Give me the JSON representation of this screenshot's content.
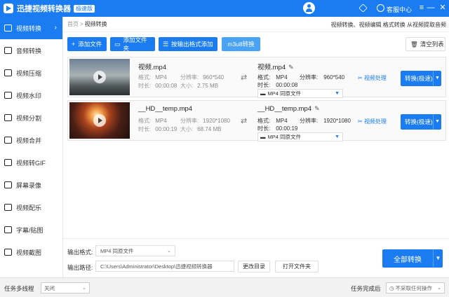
{
  "app": {
    "title": "迅捷视频转换器",
    "edition": "极速版",
    "support_label": "客服中心"
  },
  "sidebar": {
    "items": [
      {
        "label": "视频转换",
        "active": true
      },
      {
        "label": "音频转换"
      },
      {
        "label": "视频压缩"
      },
      {
        "label": "视频水印"
      },
      {
        "label": "视频分割"
      },
      {
        "label": "视频合并"
      },
      {
        "label": "视频转GIF"
      },
      {
        "label": "屏幕录像"
      },
      {
        "label": "视频配乐"
      },
      {
        "label": "字幕/贴图"
      },
      {
        "label": "视频截图"
      }
    ]
  },
  "breadcrumb": {
    "home": "首页",
    "separator": ">",
    "current": "视频转换",
    "links": "视频转换、视频编辑 格式转换 从视频提取音频"
  },
  "toolbar": {
    "add_file": "添加文件",
    "add_folder": "添加文件夹",
    "format_add": "按输出格式添加",
    "m3u8": "m3u8转换",
    "clear": "清空列表"
  },
  "files": [
    {
      "name": "视频.mp4",
      "format_label": "格式:",
      "format": "MP4",
      "res_label": "分辨率:",
      "resolution": "960*540",
      "duration_label": "时长:",
      "duration": "00:00:08",
      "size_label": "大小:",
      "size": "2.75 MB",
      "out_name": "视频.mp4",
      "out_format": "MP4",
      "out_resolution": "960*540",
      "out_duration": "00:00:08",
      "out_select": "MP4 同原文件",
      "process_label": "视频处理",
      "convert_label": "转换(极速)"
    },
    {
      "name": "__HD__temp.mp4",
      "format_label": "格式:",
      "format": "MP4",
      "res_label": "分辨率:",
      "resolution": "1920*1080",
      "duration_label": "时长:",
      "duration": "00:00:19",
      "size_label": "大小:",
      "size": "68.74 MB",
      "out_name": "__HD__temp.mp4",
      "out_format": "MP4",
      "out_resolution": "1920*1080",
      "out_duration": "00:00:19",
      "out_select": "MP4 同原文件",
      "process_label": "视频处理",
      "convert_label": "转换(极速)"
    }
  ],
  "bottom": {
    "output_format_label": "输出格式:",
    "output_format_value": "MP4 同原文件",
    "output_path_label": "输出路径:",
    "output_path_value": "C:\\Users\\Administrator\\Desktop\\迅捷视频转换器",
    "change_dir": "更改目录",
    "open_folder": "打开文件夹",
    "convert_all": "全部转换"
  },
  "statusbar": {
    "multithread_label": "任务多线程",
    "multithread_value": "关闭",
    "after_done_label": "任务完成后",
    "after_done_value": "不采取任何操作"
  },
  "colors": {
    "accent": "#1a7cf0"
  }
}
